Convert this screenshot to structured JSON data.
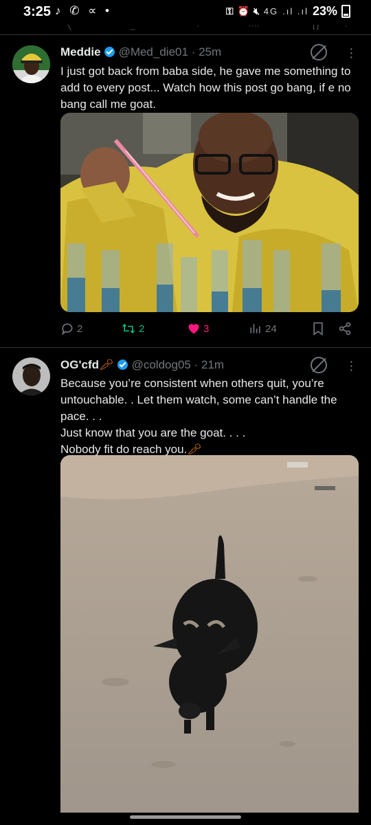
{
  "status_bar": {
    "time": "3:25",
    "left_icons": "♪ ✆ ∝ •",
    "network": "4G",
    "battery": "23%"
  },
  "tweets": [
    {
      "name": "Meddie",
      "handle": "@Med_die01",
      "time": "· 25m",
      "text": [
        "I just got back from baba side, he gave me something to add to every post... Watch how this post go bang, if e no bang call me goat."
      ],
      "replies": "2",
      "reposts": "2",
      "likes": "3",
      "views": "24",
      "image_desc": "man in yellow protective suit holding pipette over test tubes"
    },
    {
      "name": "OG'cfd",
      "handle": "@coldog05",
      "time": "· 21m",
      "text": [
        "Because you’re consistent when others quit, you’re untouchable. . Let them watch, some can’t handle the pace. . .",
        "Just know that you are the goat. . . .",
        "Nobody fit do reach you."
      ],
      "image_desc": "black goat standing on sandy ground"
    }
  ],
  "colors": {
    "accent": "#1d9bf0",
    "like": "#f91880",
    "repost": "#00ba7c",
    "muted": "#71767b"
  }
}
